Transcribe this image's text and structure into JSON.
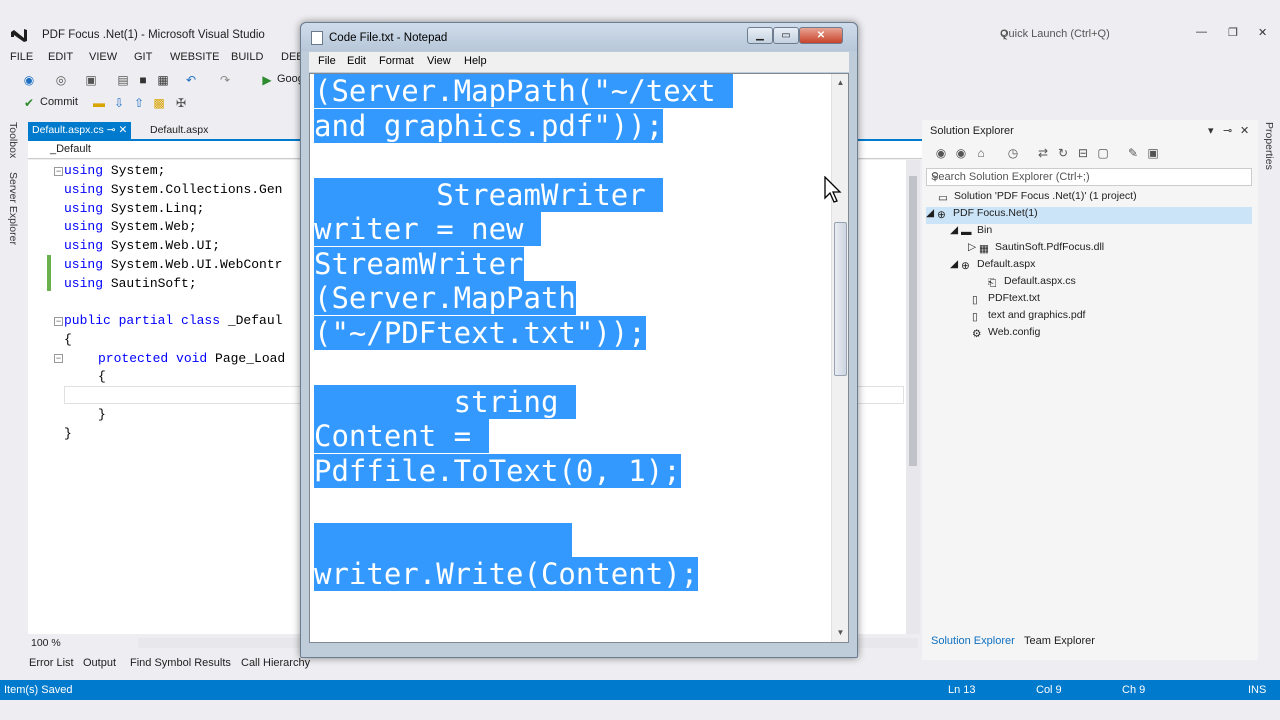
{
  "vs": {
    "title": "PDF Focus .Net(1) - Microsoft Visual Studio",
    "quick_launch_placeholder": "Quick Launch (Ctrl+Q)",
    "menu": [
      "FILE",
      "EDIT",
      "VIEW",
      "GIT",
      "WEBSITE",
      "BUILD",
      "DEBU"
    ],
    "toolbar": {
      "browser_label": "Goog",
      "commit_label": "Commit"
    },
    "left_tabs": [
      "Toolbox",
      "Server Explorer"
    ],
    "doc_tabs": [
      {
        "label": "Default.aspx.cs",
        "active": true
      },
      {
        "label": "Default.aspx",
        "active": false
      }
    ],
    "nav_class": "_Default",
    "code": {
      "usings": [
        {
          "kw": "using",
          "rest": " System;"
        },
        {
          "kw": "using",
          "rest": " System.Collections.Gen"
        },
        {
          "kw": "using",
          "rest": " System.Linq;"
        },
        {
          "kw": "using",
          "rest": " System.Web;"
        },
        {
          "kw": "using",
          "rest": " System.Web.UI;"
        },
        {
          "kw": "using",
          "rest": " System.Web.UI.WebContr"
        },
        {
          "kw": "using",
          "rest": " SautinSoft;"
        }
      ],
      "class_kw": "public partial class",
      "class_name": " _Defaul",
      "open_brace": "{",
      "method_kw": "protected void",
      "method_name": " Page_Load",
      "inner_open": "{",
      "inner_close": "}",
      "close_brace": "}"
    },
    "zoom": "100 %",
    "bottom_tabs": [
      "Error List",
      "Output",
      "Find Symbol Results",
      "Call Hierarchy"
    ],
    "status": {
      "message": "Item(s) Saved",
      "line": "Ln 13",
      "col": "Col 9",
      "ch": "Ch 9",
      "mode": "INS"
    },
    "accent_color": "#007acc"
  },
  "solution_explorer": {
    "title": "Solution Explorer",
    "search_placeholder": "Search Solution Explorer (Ctrl+;)",
    "tree": [
      {
        "label": "Solution 'PDF Focus .Net(1)' (1 project)",
        "icon": "solution-icon"
      },
      {
        "label": "PDF Focus.Net(1)",
        "icon": "web-project-icon"
      },
      {
        "label": "Bin",
        "icon": "folder-icon"
      },
      {
        "label": "SautinSoft.PdfFocus.dll",
        "icon": "dll-icon"
      },
      {
        "label": "Default.aspx",
        "icon": "aspx-icon"
      },
      {
        "label": "Default.aspx.cs",
        "icon": "cs-file-icon"
      },
      {
        "label": "PDFtext.txt",
        "icon": "text-file-icon"
      },
      {
        "label": "text and graphics.pdf",
        "icon": "pdf-file-icon"
      },
      {
        "label": "Web.config",
        "icon": "config-icon"
      }
    ],
    "footer_tabs": [
      "Solution Explorer",
      "Team Explorer"
    ],
    "right_tabs": [
      "Properties"
    ]
  },
  "notepad": {
    "title": "Code File.txt - Notepad",
    "menu": [
      "File",
      "Edit",
      "Format",
      "View",
      "Help"
    ],
    "lines": [
      "(Server.MapPath(\"~/text",
      "and graphics.pdf\"));",
      "",
      "       StreamWriter",
      "writer = new",
      "StreamWriter",
      "(Server.MapPath",
      "(\"~/PDFtext.txt\"));",
      "",
      "        string",
      "Content =",
      "Pdffile.ToText(0, 1);",
      "",
      "",
      "writer.Write(Content);"
    ],
    "selection_color": "#3399ff"
  }
}
